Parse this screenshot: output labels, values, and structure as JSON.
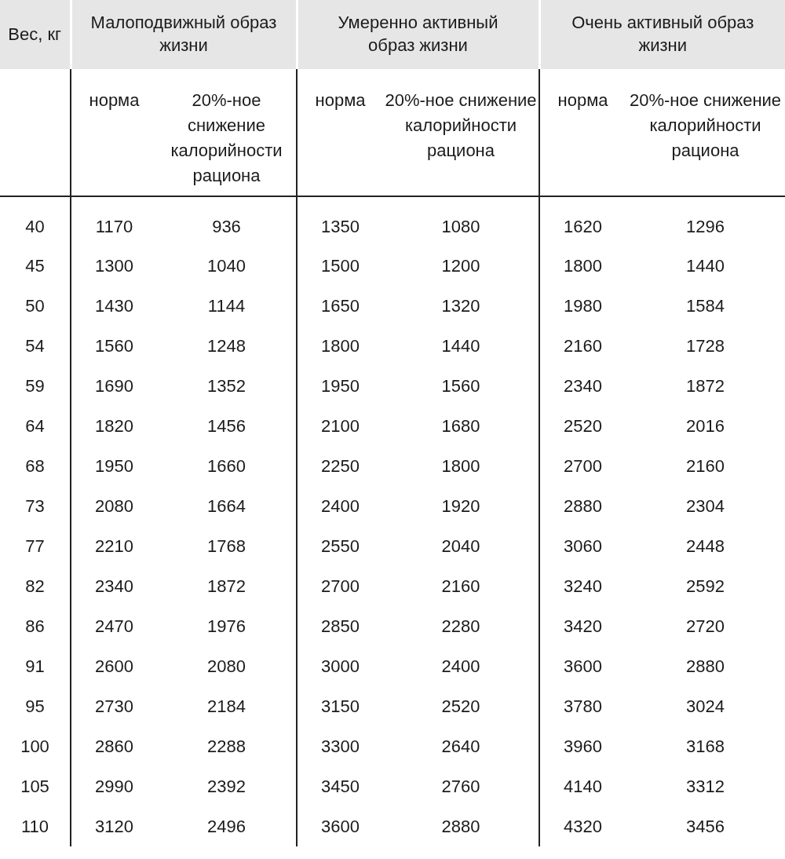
{
  "table": {
    "corner_header": "Вес, кг",
    "groups": [
      {
        "title": "Малоподвижный образ жизни",
        "subheaders": [
          "норма",
          "20%-ное снижение калорийности рациона"
        ]
      },
      {
        "title": "Умеренно активный образ жизни",
        "subheaders": [
          "норма",
          "20%-ное снижение калорийности рациона"
        ]
      },
      {
        "title": "Очень активный образ жизни",
        "subheaders": [
          "норма",
          "20%-ное снижение калорийности рациона"
        ]
      }
    ],
    "rows": [
      [
        "40",
        "1170",
        "936",
        "1350",
        "1080",
        "1620",
        "1296"
      ],
      [
        "45",
        "1300",
        "1040",
        "1500",
        "1200",
        "1800",
        "1440"
      ],
      [
        "50",
        "1430",
        "1144",
        "1650",
        "1320",
        "1980",
        "1584"
      ],
      [
        "54",
        "1560",
        "1248",
        "1800",
        "1440",
        "2160",
        "1728"
      ],
      [
        "59",
        "1690",
        "1352",
        "1950",
        "1560",
        "2340",
        "1872"
      ],
      [
        "64",
        "1820",
        "1456",
        "2100",
        "1680",
        "2520",
        "2016"
      ],
      [
        "68",
        "1950",
        "1660",
        "2250",
        "1800",
        "2700",
        "2160"
      ],
      [
        "73",
        "2080",
        "1664",
        "2400",
        "1920",
        "2880",
        "2304"
      ],
      [
        "77",
        "2210",
        "1768",
        "2550",
        "2040",
        "3060",
        "2448"
      ],
      [
        "82",
        "2340",
        "1872",
        "2700",
        "2160",
        "3240",
        "2592"
      ],
      [
        "86",
        "2470",
        "1976",
        "2850",
        "2280",
        "3420",
        "2720"
      ],
      [
        "91",
        "2600",
        "2080",
        "3000",
        "2400",
        "3600",
        "2880"
      ],
      [
        "95",
        "2730",
        "2184",
        "3150",
        "2520",
        "3780",
        "3024"
      ],
      [
        "100",
        "2860",
        "2288",
        "3300",
        "2640",
        "3960",
        "3168"
      ],
      [
        "105",
        "2990",
        "2392",
        "3450",
        "2760",
        "4140",
        "3312"
      ],
      [
        "110",
        "3120",
        "2496",
        "3600",
        "2880",
        "4320",
        "3456"
      ]
    ]
  }
}
